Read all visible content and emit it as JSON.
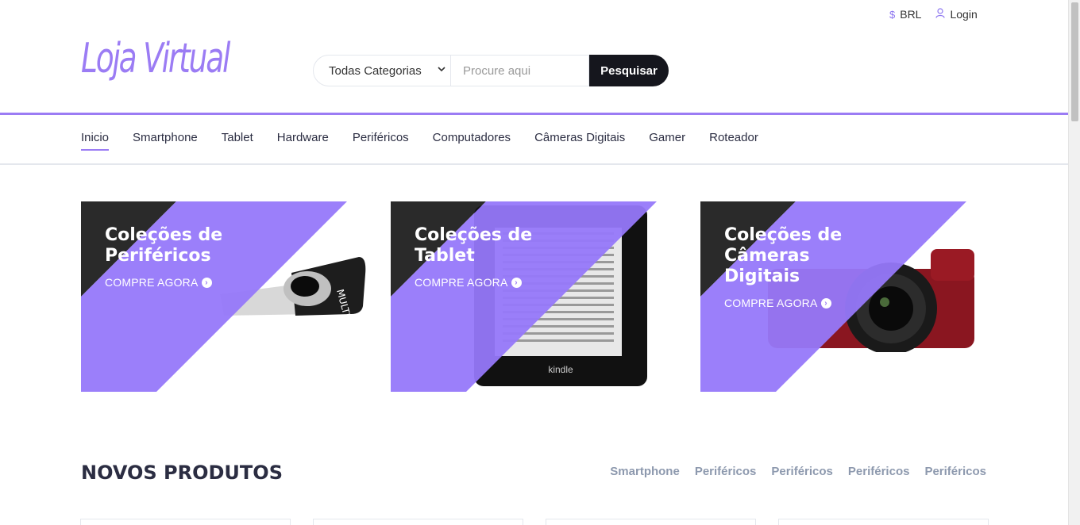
{
  "topbar": {
    "currency_icon": "dollar-icon",
    "currency": "BRL",
    "login_icon": "user-icon",
    "login": "Login"
  },
  "brand": {
    "logo_text": "Loja Virtual",
    "accent_color": "#9b7cf4"
  },
  "search": {
    "category_selected": "Todas Categorias",
    "placeholder": "Procure aqui",
    "button": "Pesquisar"
  },
  "nav": {
    "items": [
      {
        "label": "Inicio",
        "active": true
      },
      {
        "label": "Smartphone"
      },
      {
        "label": "Tablet"
      },
      {
        "label": "Hardware"
      },
      {
        "label": "Periféricos"
      },
      {
        "label": "Computadores"
      },
      {
        "label": "Câmeras Digitais"
      },
      {
        "label": "Gamer"
      },
      {
        "label": "Roteador"
      }
    ]
  },
  "collections": [
    {
      "title_line1": "Coleções de",
      "title_line2": "Periféricos",
      "cta": "COMPRE AGORA"
    },
    {
      "title_line1": "Coleções de",
      "title_line2": "Tablet",
      "cta": "COMPRE AGORA"
    },
    {
      "title_line1": "Coleções de",
      "title_line2": "Câmeras Digitais",
      "cta": "COMPRE AGORA"
    }
  ],
  "new_products": {
    "title": "NOVOS PRODUTOS",
    "tabs": [
      "Smartphone",
      "Periféricos",
      "Periféricos",
      "Periféricos",
      "Periféricos"
    ]
  }
}
